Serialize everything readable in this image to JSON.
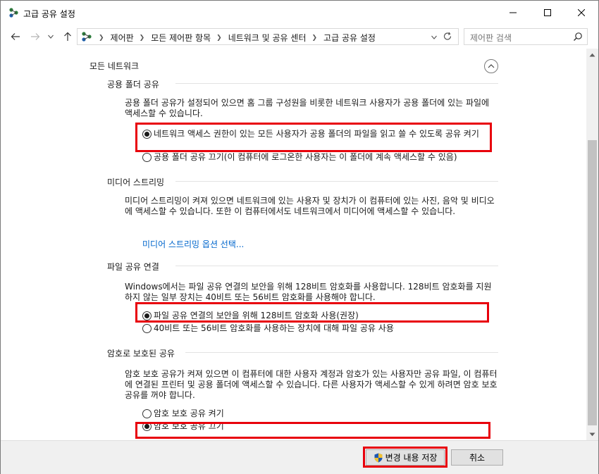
{
  "window": {
    "title": "고급 공유 설정"
  },
  "nav": {
    "back_icon": "arrow-left-icon",
    "forward_icon": "arrow-right-icon",
    "recent_icon": "chevron-down-icon",
    "up_icon": "arrow-up-icon",
    "breadcrumbs": [
      "제어판",
      "모든 제어판 항목",
      "네트워크 및 공유 센터",
      "고급 공유 설정"
    ],
    "search_placeholder": "제어판 검색"
  },
  "profile": {
    "title": "모든 네트워크"
  },
  "sections": {
    "public_folder": {
      "title": "공용 폴더 공유",
      "description": "공용 폴더 공유가 설정되어 있으면 홈 그룹 구성원을 비롯한 네트워크 사용자가 공용 폴더에 있는 파일에 액세스할 수 있습니다.",
      "option_on": "네트워크 액세스 권한이 있는 모든 사용자가 공용 폴더의 파일을 읽고 쓸 수 있도록 공유 켜기",
      "option_off": "공용 폴더 공유 끄기(이 컴퓨터에 로그온한 사용자는 이 폴더에 계속 액세스할 수 있음)",
      "selected": "on"
    },
    "media": {
      "title": "미디어 스트리밍",
      "description": "미디어 스트리밍이 켜져 있으면 네트워크에 있는 사용자 및 장치가 이 컴퓨터에 있는 사진, 음악 및 비디오에 액세스할 수 있습니다. 또한 이 컴퓨터에서도 네트워크에서 미디어에 액세스할 수 있습니다.",
      "link": "미디어 스트리밍 옵션 선택..."
    },
    "file_sharing": {
      "title": "파일 공유 연결",
      "description": "Windows에서는 파일 공유 연결의 보안을 위해 128비트 암호화를 사용합니다. 128비트 암호화를 지원하지 않는 일부 장치는 40비트 또는 56비트 암호화를 사용해야 합니다.",
      "option_128": "파일 공유 연결의 보안을 위해 128비트 암호화 사용(권장)",
      "option_40_56": "40비트 또는 56비트 암호화를 사용하는 장치에 대해 파일 공유 사용",
      "selected": "128"
    },
    "password": {
      "title": "암호로 보호된 공유",
      "description": "암호 보호 공유가 켜져 있으면 이 컴퓨터에 대한 사용자 계정과 암호가 있는 사용자만 공유 파일, 이 컴퓨터에 연결된 프린터 및 공용 폴더에 액세스할 수 있습니다. 다른 사용자가 액세스할 수 있게 하려면 암호 보호 공유를 꺼야 합니다.",
      "option_on": "암호 보호 공유 켜기",
      "option_off": "암호 보호 공유 끄기",
      "selected": "off"
    }
  },
  "buttons": {
    "save": "변경 내용 저장",
    "cancel": "취소"
  },
  "colors": {
    "highlight": "#e8000b",
    "link": "#0066cc"
  }
}
